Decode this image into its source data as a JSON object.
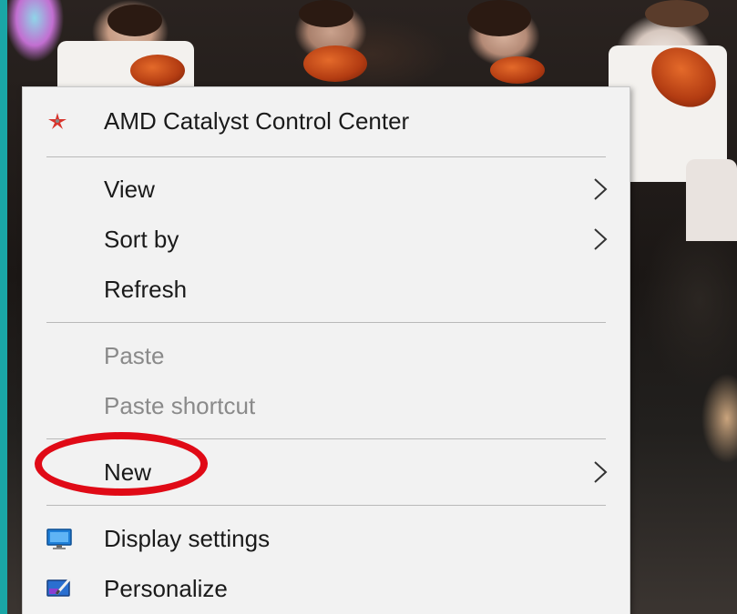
{
  "context_menu": {
    "items": [
      {
        "label": "AMD Catalyst Control Center",
        "icon": "amd-catalyst-icon",
        "submenu": false,
        "disabled": false
      },
      {
        "label": "View",
        "submenu": true,
        "disabled": false
      },
      {
        "label": "Sort by",
        "submenu": true,
        "disabled": false
      },
      {
        "label": "Refresh",
        "submenu": false,
        "disabled": false
      },
      {
        "label": "Paste",
        "submenu": false,
        "disabled": true
      },
      {
        "label": "Paste shortcut",
        "submenu": false,
        "disabled": true
      },
      {
        "label": "New",
        "submenu": true,
        "disabled": false,
        "highlighted_by_annotation": true
      },
      {
        "label": "Display settings",
        "icon": "display-settings-icon",
        "submenu": false,
        "disabled": false
      },
      {
        "label": "Personalize",
        "icon": "personalize-icon",
        "submenu": false,
        "disabled": false
      }
    ]
  },
  "colors": {
    "desktop_border": "#1aa6a6",
    "menu_background": "#f2f2f2",
    "disabled_text": "#8a8a8a",
    "annotation_red": "#e00a16"
  }
}
